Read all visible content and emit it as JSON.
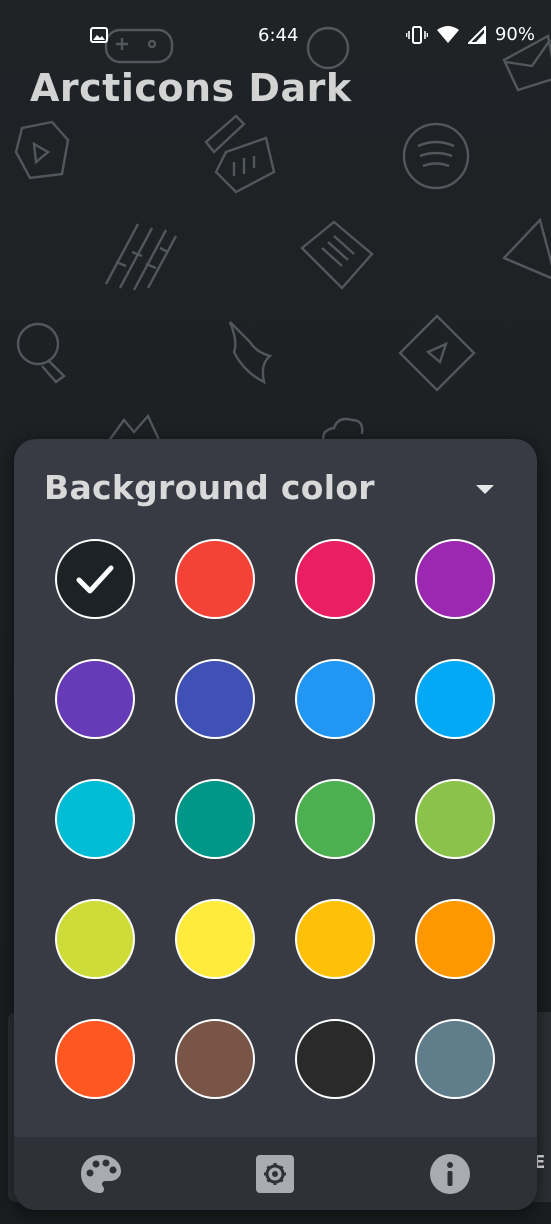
{
  "status_bar": {
    "time": "6:44",
    "battery": "90%",
    "icons": [
      "image-icon",
      "vibrate-icon",
      "wifi-icon",
      "signal-icon"
    ]
  },
  "app": {
    "title": "Arcticons Dark"
  },
  "panel": {
    "title": "Background color",
    "dropdown_icon": "triangle-down-icon",
    "selected_index": 0,
    "swatches": [
      {
        "name": "dark",
        "color": "#1c2226",
        "selected": true
      },
      {
        "name": "red",
        "color": "#f44336"
      },
      {
        "name": "pink",
        "color": "#e91e63"
      },
      {
        "name": "purple",
        "color": "#9c27b0"
      },
      {
        "name": "deep-purple",
        "color": "#673ab7"
      },
      {
        "name": "indigo",
        "color": "#3f51b5"
      },
      {
        "name": "blue",
        "color": "#2196f3"
      },
      {
        "name": "light-blue",
        "color": "#03a9f4"
      },
      {
        "name": "cyan",
        "color": "#00bcd4"
      },
      {
        "name": "teal",
        "color": "#009688"
      },
      {
        "name": "green",
        "color": "#4caf50"
      },
      {
        "name": "light-green",
        "color": "#8bc34a"
      },
      {
        "name": "lime",
        "color": "#cddc39"
      },
      {
        "name": "yellow",
        "color": "#ffeb3b"
      },
      {
        "name": "amber",
        "color": "#ffc107"
      },
      {
        "name": "orange",
        "color": "#ff9800"
      },
      {
        "name": "deep-orange",
        "color": "#ff5722"
      },
      {
        "name": "brown",
        "color": "#795548"
      },
      {
        "name": "near-black",
        "color": "#2a2a2a"
      },
      {
        "name": "blue-grey",
        "color": "#607d8b"
      }
    ]
  },
  "bottom_nav": {
    "items": [
      {
        "icon": "palette-icon"
      },
      {
        "icon": "settings-icon"
      },
      {
        "icon": "info-icon"
      }
    ]
  },
  "peek_card": {
    "text": "E"
  },
  "colors": {
    "panel_bg": "#383a44",
    "nav_bg": "#2f3138",
    "wallpaper_bg": "#1b1e21",
    "title_text": "#d3d3d3"
  }
}
